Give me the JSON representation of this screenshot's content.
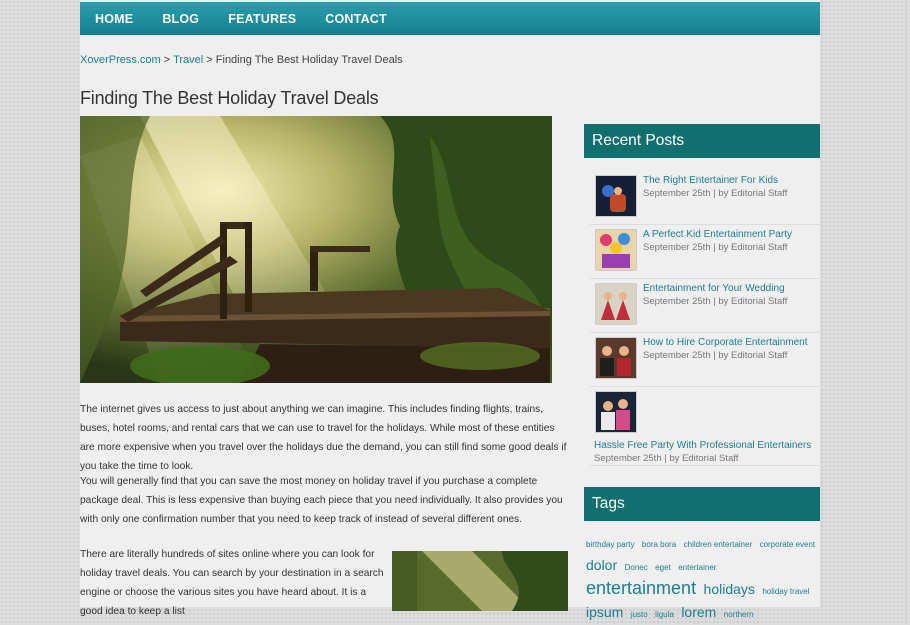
{
  "nav": {
    "items": [
      "Home",
      "Blog",
      "Features",
      "Contact"
    ]
  },
  "breadcrumb": {
    "home": "XoverPress.com",
    "sep1": ">",
    "category": "Travel",
    "sep2": ">",
    "current": "Finding The Best Holiday Travel Deals"
  },
  "article": {
    "title": "Finding The Best Holiday Travel Deals",
    "paragraphs": [
      "The internet gives us access to just about anything we can imagine. This includes finding flights, trains, buses, hotel rooms, and rental cars that we can use to travel for the holidays. While most of these entities are more expensive when you travel over the holidays due the demand, you can still find some good deals if you take the time to look.",
      "You will generally find that you can save the most money on holiday travel if you purchase a complete package deal. This is less expensive than buying each piece that you need individually. It also provides you with only one confirmation number that you need to keep track of instead of several different ones.",
      "There are literally hundreds of sites online where you can look for holiday travel deals. You can search by your destination in a search engine or choose the various sites you have heard about. It is a good idea to keep a list"
    ]
  },
  "sidebar": {
    "recent_title": "Recent Posts",
    "posts": [
      {
        "title": "The Right Entertainer For Kids",
        "meta": "September 25th | by Editorial Staff"
      },
      {
        "title": "A Perfect Kid Entertainment Party",
        "meta": "September 25th | by Editorial Staff"
      },
      {
        "title": "Entertainment for Your Wedding",
        "meta": "September 25th | by Editorial Staff"
      },
      {
        "title": "How to Hire Corporate Entertainment",
        "meta": "September 25th | by Editorial Staff"
      },
      {
        "title": "Hassle Free Party With Professional Entertainers",
        "meta": "September 25th | by Editorial Staff"
      }
    ],
    "tags_title": "Tags",
    "tags": [
      {
        "text": "birthday party",
        "size": 8
      },
      {
        "text": "bora bora",
        "size": 8
      },
      {
        "text": "children entertainer",
        "size": 8
      },
      {
        "text": "corporate event",
        "size": 8
      },
      {
        "text": "dolor",
        "size": 14
      },
      {
        "text": "Donec",
        "size": 8
      },
      {
        "text": "eget",
        "size": 8
      },
      {
        "text": "entertainer",
        "size": 8
      },
      {
        "text": "entertainment",
        "size": 18
      },
      {
        "text": "holidays",
        "size": 14
      },
      {
        "text": "holiday travel",
        "size": 8
      },
      {
        "text": "ipsum",
        "size": 14
      },
      {
        "text": "justo",
        "size": 8
      },
      {
        "text": "ligula",
        "size": 8
      },
      {
        "text": "lorem",
        "size": 14
      },
      {
        "text": "northern",
        "size": 8
      }
    ]
  },
  "colors": {
    "nav_top": "#2a9eae",
    "nav_bottom": "#14808f",
    "sidebar_header": "#116f6f",
    "link": "#1d7f91"
  }
}
